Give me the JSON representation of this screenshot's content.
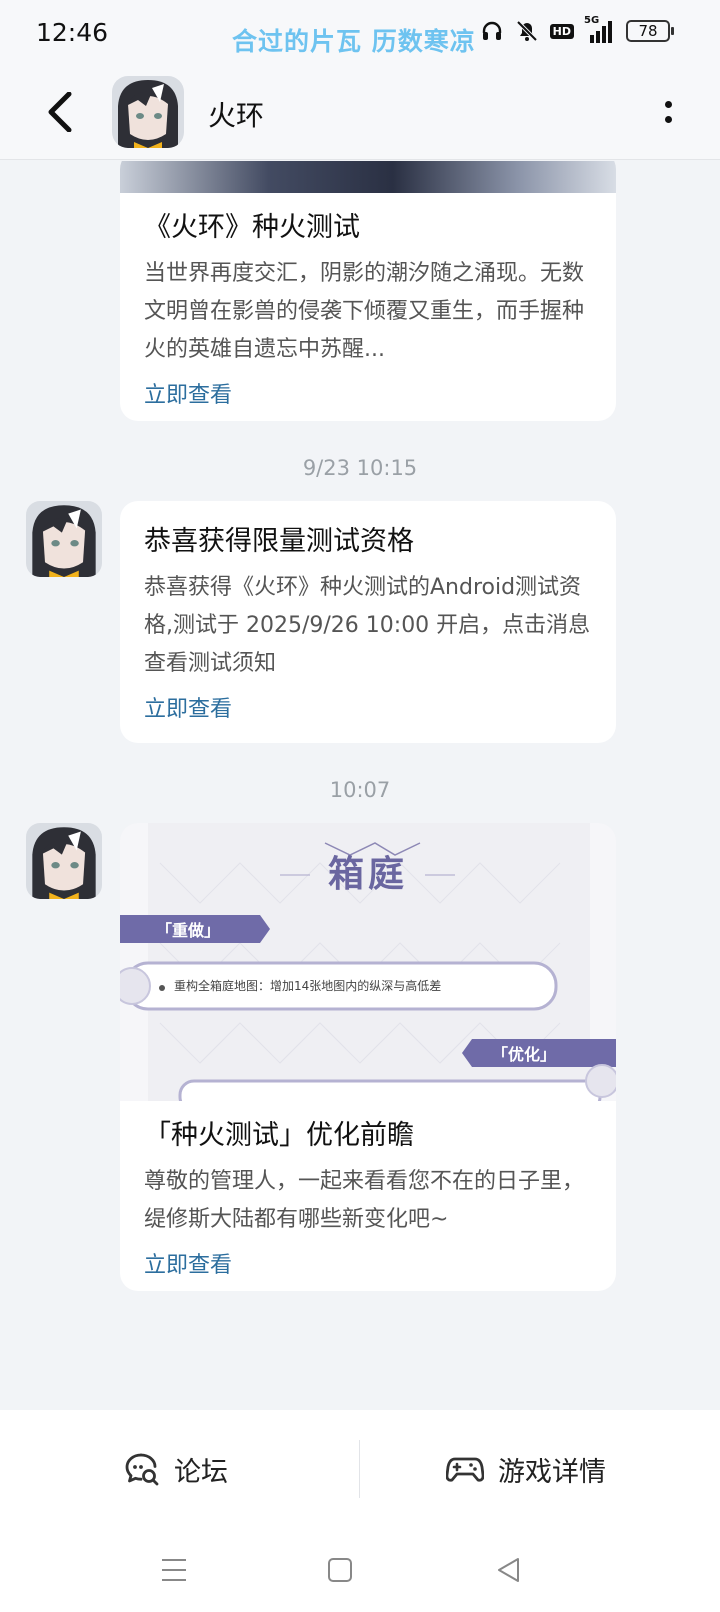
{
  "status_bar": {
    "time": "12:46",
    "lyric": "合过的片瓦 历数寒凉",
    "network": "5G",
    "hd": "HD",
    "battery": "78"
  },
  "header": {
    "title": "火环"
  },
  "messages": [
    {
      "title": "《火环》种火测试",
      "body": "当世界再度交汇，阴影的潮汐随之涌现。无数文明曾在影兽的侵袭下倾覆又重生，而手握种火的英雄自遗忘中苏醒...",
      "link": "立即查看"
    },
    {
      "timestamp": "9/23  10:15",
      "title": "恭喜获得限量测试资格",
      "body": "恭喜获得《火环》种火测试的Android测试资格,测试于 2025/9/26 10:00 开启，点击消息查看测试须知",
      "link": "立即查看"
    },
    {
      "timestamp": "10:07",
      "image": {
        "heading": "箱庭",
        "tag_left": "「重做」",
        "item": "重构全箱庭地图：增加14张地图内的纵深与高低差",
        "tag_right": "「优化」"
      },
      "title": "「种火测试」优化前瞻",
      "body": "尊敬的管理人，一起来看看您不在的日子里，缇修斯大陆都有哪些新变化吧~",
      "link": "立即查看"
    }
  ],
  "bottom_tabs": {
    "forum": "论坛",
    "game_details": "游戏详情"
  },
  "colors": {
    "background": "#f2f4f7",
    "link": "#2c6e9e",
    "lyric": "#6ec3f0",
    "promo_accent": "#6f6ba8"
  }
}
